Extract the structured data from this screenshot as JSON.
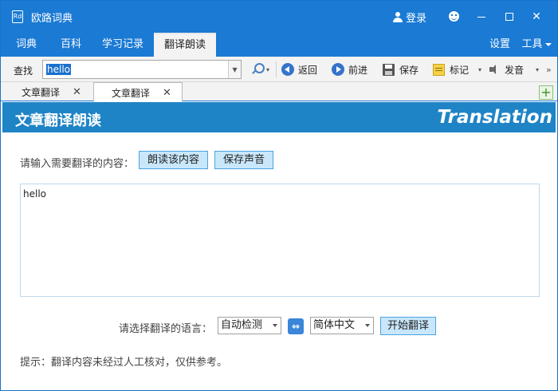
{
  "app": {
    "title": "欧路词典",
    "icon_text": "Rd",
    "login_label": "登录"
  },
  "menu": {
    "tabs": [
      "词典",
      "百科",
      "学习记录",
      "翻译朗读"
    ],
    "right": [
      "设置",
      "工具"
    ]
  },
  "toolbar": {
    "lookup_label": "查找",
    "search_value": "hello",
    "back_label": "返回",
    "forward_label": "前进",
    "save_label": "保存",
    "mark_label": "标记",
    "speak_label": "发音"
  },
  "doc_tabs": [
    "文章翻译",
    "文章翻译"
  ],
  "banner": {
    "title": "文章翻译朗读",
    "subtitle_en": "Translation"
  },
  "content": {
    "prompt": "请输入需要翻译的内容：",
    "read_button": "朗读该内容",
    "save_voice_button": "保存声音",
    "input_text": "hello",
    "lang_prompt": "请选择翻译的语言：",
    "source_lang": "自动检测",
    "target_lang": "简体中文",
    "translate_button": "开始翻译",
    "hint": "提示：翻译内容未经过人工核对，仅供参考。"
  },
  "colors": {
    "accent": "#1a7ad4",
    "banner": "#1f84c6",
    "button_bg": "#c9e7fb"
  },
  "icons": [
    "app-icon",
    "user-icon",
    "smiley-icon",
    "minimize-icon",
    "maximize-icon",
    "close-icon",
    "search-icon",
    "back-icon",
    "forward-icon",
    "save-icon",
    "mark-icon",
    "speaker-icon",
    "add-tab-icon",
    "swap-icon"
  ]
}
